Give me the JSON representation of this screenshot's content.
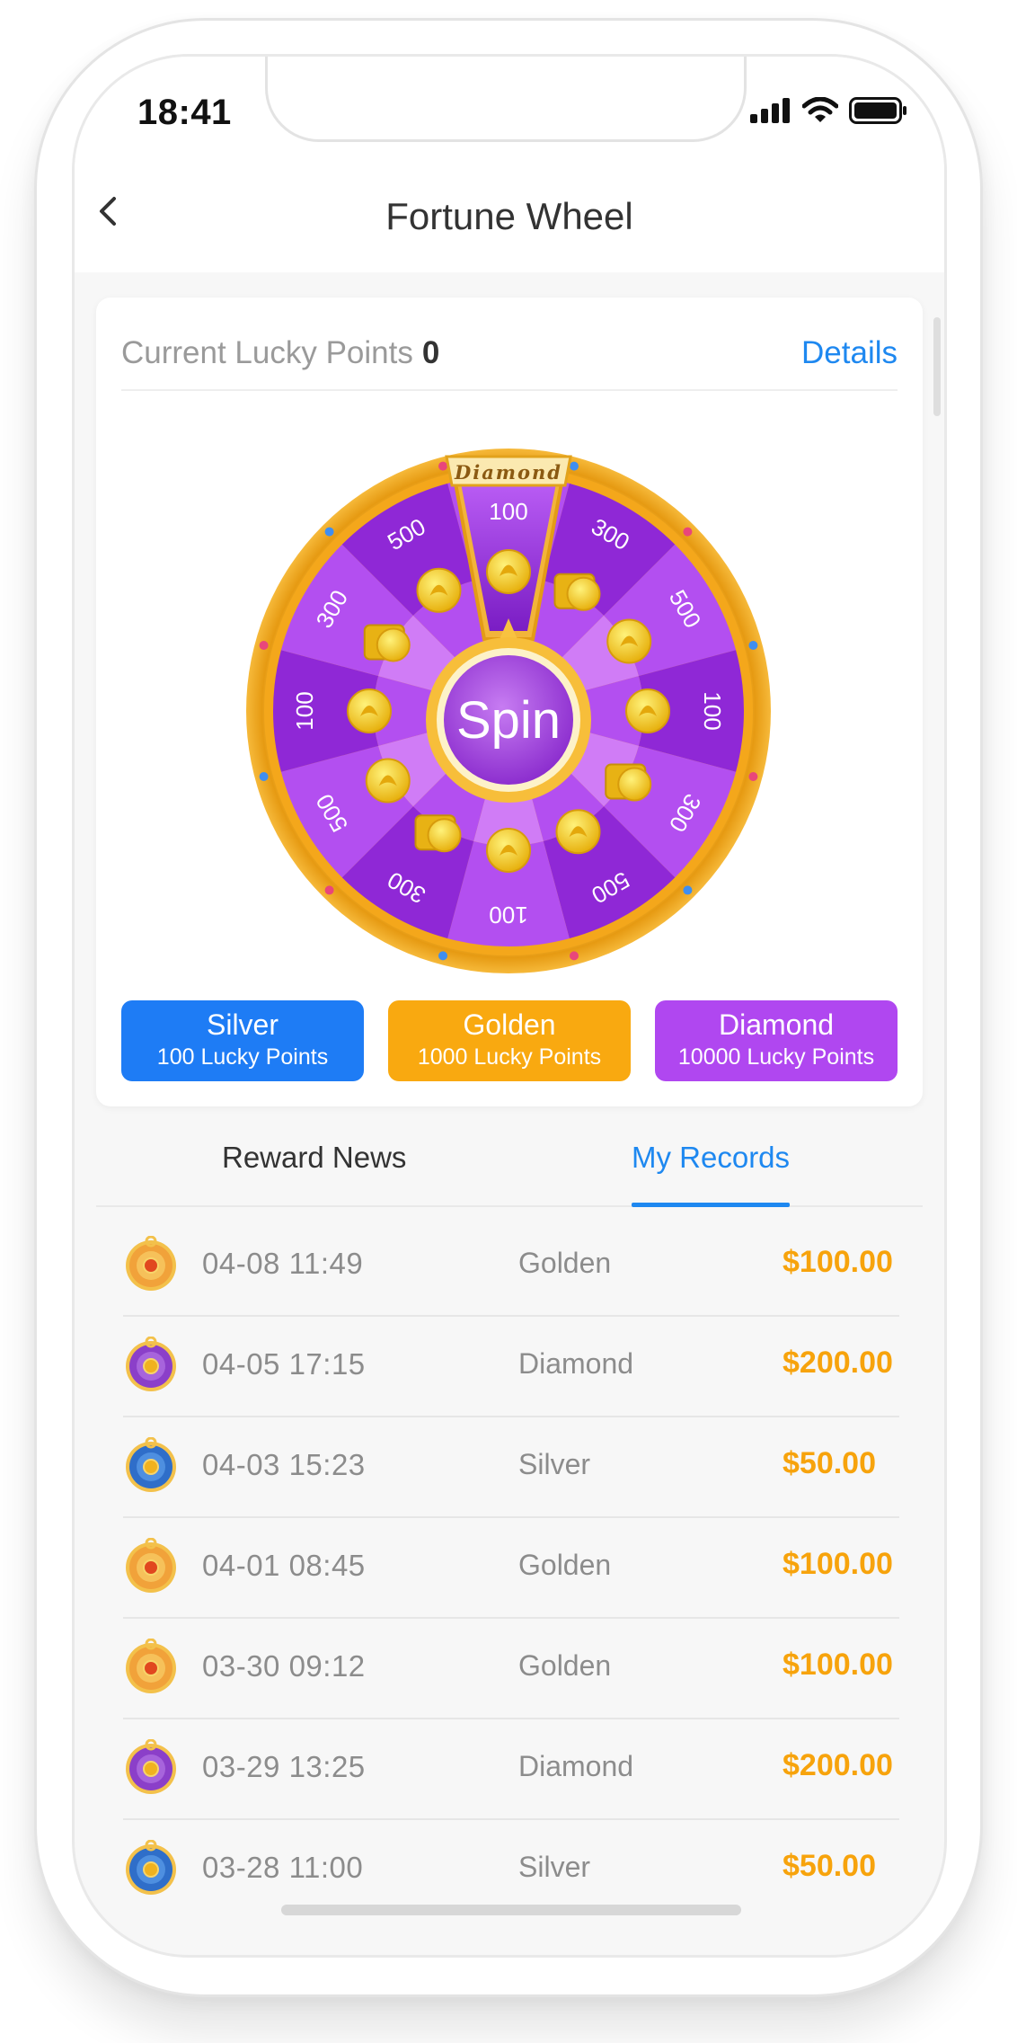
{
  "status": {
    "time": "18:41"
  },
  "header": {
    "title": "Fortune Wheel"
  },
  "points": {
    "label": "Current Lucky Points",
    "value": "0",
    "details_label": "Details"
  },
  "wheel": {
    "spin_label": "Spin",
    "pointer_label": "Diamond",
    "segment_values": [
      "100",
      "300",
      "500",
      "100",
      "300",
      "500",
      "100",
      "300",
      "500",
      "100",
      "300",
      "500"
    ],
    "colors": {
      "purple_dark": "#8f28d6",
      "purple_mid": "#b34ff0",
      "purple_light": "#d07cf6",
      "gold": "#f7b320"
    }
  },
  "tiers": [
    {
      "name": "Silver",
      "points": "100 Lucky Points",
      "color": "#1e7cf5"
    },
    {
      "name": "Golden",
      "points": "1000 Lucky Points",
      "color": "#f9a910"
    },
    {
      "name": "Diamond",
      "points": "10000 Lucky Points",
      "color": "#b047f0"
    }
  ],
  "tabs": {
    "left": "Reward News",
    "right": "My Records",
    "active": "My Records"
  },
  "records": [
    {
      "date": "04-08 11:49",
      "tier": "Golden",
      "amount": "$100.00",
      "medal": "golden-medal-icon"
    },
    {
      "date": "04-05 17:15",
      "tier": "Diamond",
      "amount": "$200.00",
      "medal": "diamond-medal-icon"
    },
    {
      "date": "04-03 15:23",
      "tier": "Silver",
      "amount": "$50.00",
      "medal": "silver-medal-icon"
    },
    {
      "date": "04-01 08:45",
      "tier": "Golden",
      "amount": "$100.00",
      "medal": "golden-medal-icon"
    },
    {
      "date": "03-30 09:12",
      "tier": "Golden",
      "amount": "$100.00",
      "medal": "golden-medal-icon"
    },
    {
      "date": "03-29 13:25",
      "tier": "Diamond",
      "amount": "$200.00",
      "medal": "diamond-medal-icon"
    },
    {
      "date": "03-28 11:00",
      "tier": "Silver",
      "amount": "$50.00",
      "medal": "silver-medal-icon"
    }
  ]
}
